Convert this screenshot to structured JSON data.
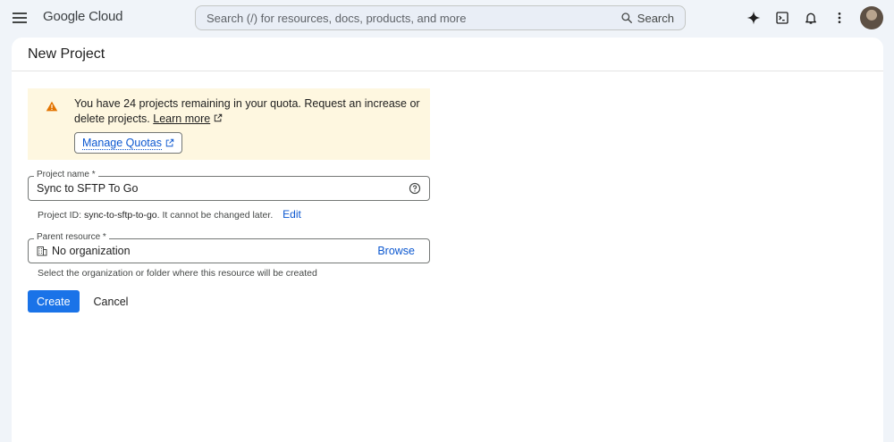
{
  "header": {
    "brand": "Google Cloud",
    "search_placeholder": "Search (/) for resources, docs, products, and more",
    "search_button": "Search"
  },
  "page": {
    "title": "New Project"
  },
  "quota_warning": {
    "text": "You have 24 projects remaining in your quota. Request an increase or delete projects.",
    "learn_more": "Learn more",
    "manage_quotas": "Manage Quotas"
  },
  "project_name": {
    "label": "Project name *",
    "value": "Sync to SFTP To Go",
    "hint_prefix": "Project ID: ",
    "project_id": "sync-to-sftp-to-go",
    "hint_suffix": ". It cannot be changed later.",
    "edit": "Edit"
  },
  "parent_resource": {
    "label": "Parent resource *",
    "value": "No organization",
    "browse": "Browse",
    "hint": "Select the organization or folder where this resource will be created"
  },
  "actions": {
    "create": "Create",
    "cancel": "Cancel"
  },
  "colors": {
    "accent": "#1a73e8",
    "link": "#0b57d0",
    "warning_bg": "#fef7e0",
    "warning_icon": "#e37400"
  }
}
